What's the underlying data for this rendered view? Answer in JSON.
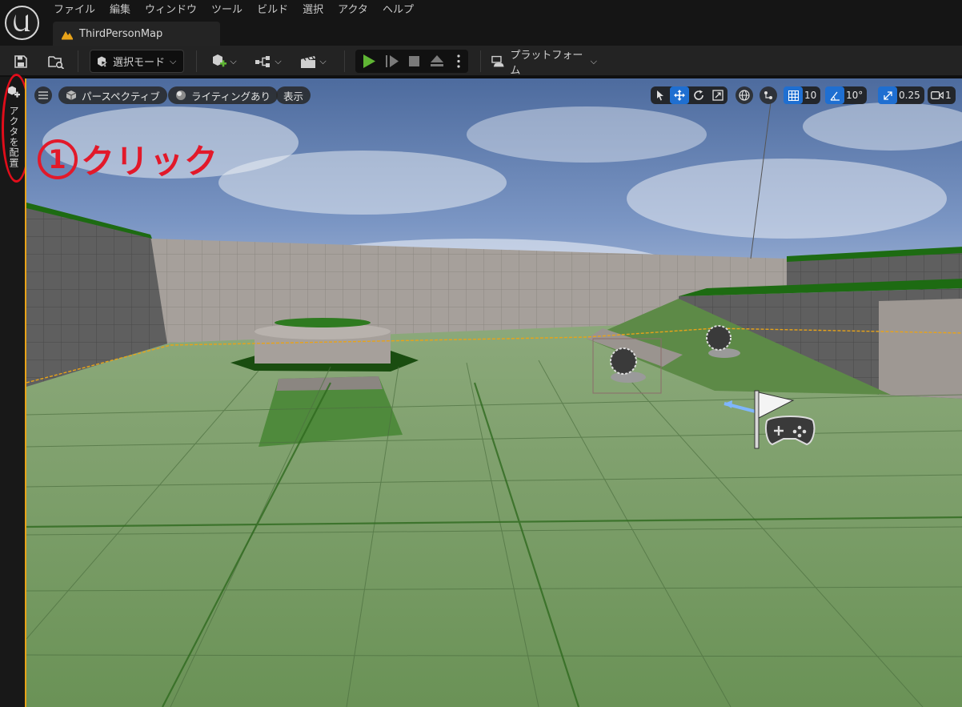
{
  "menu": [
    "ファイル",
    "編集",
    "ウィンドウ",
    "ツール",
    "ビルド",
    "選択",
    "アクタ",
    "ヘルプ"
  ],
  "tab": {
    "label": "ThirdPersonMap"
  },
  "toolbar": {
    "select_mode_label": "選択モード",
    "platform_label": "プラットフォーム"
  },
  "left_panel": {
    "place_actor_label": "アクタを配置"
  },
  "viewport": {
    "perspective_label": "パースペクティブ",
    "lighting_label": "ライティングあり",
    "show_label": "表示",
    "grid_snap_value": "10",
    "rotation_snap_value": "10°",
    "scale_snap_value": "0.25",
    "camera_speed_value": "1"
  },
  "annotation": {
    "number": "1",
    "text": "クリック"
  },
  "colors": {
    "accent_blue": "#1f6fd1",
    "play_green": "#5fb534",
    "annotation_red": "#e2192a",
    "floor_green": "#6d9a5a"
  },
  "icons": [
    "unreal-logo-icon",
    "save-icon",
    "content-browser-icon",
    "add-actor-icon",
    "blueprint-icon",
    "cinematics-icon",
    "play-icon",
    "skip-icon",
    "stop-icon",
    "eject-icon",
    "more-icon",
    "platform-icon",
    "menu-icon",
    "cube-icon",
    "lighting-icon",
    "select-icon",
    "translate-icon",
    "rotate-icon",
    "scale-icon",
    "world-icon",
    "surface-snap-icon",
    "grid-icon",
    "angle-icon",
    "scale-snap-icon",
    "camera-icon"
  ]
}
